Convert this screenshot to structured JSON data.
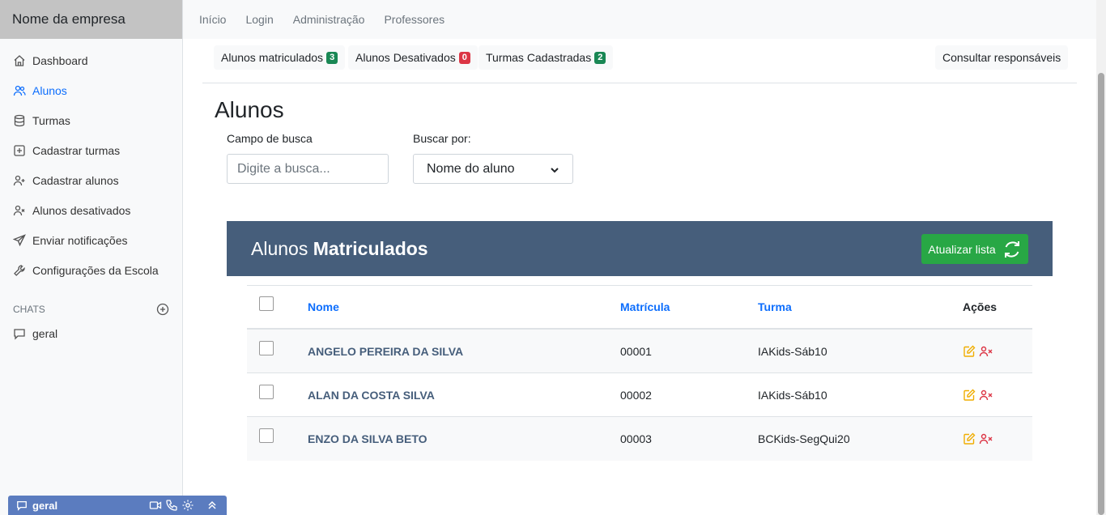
{
  "app": {
    "brand": "Nome da empresa"
  },
  "topnav": [
    "Início",
    "Login",
    "Administração",
    "Professores"
  ],
  "sidebar": {
    "items": [
      {
        "label": "Dashboard",
        "icon": "home-icon",
        "active": false
      },
      {
        "label": "Alunos",
        "icon": "users-icon",
        "active": true
      },
      {
        "label": "Turmas",
        "icon": "database-icon",
        "active": false
      },
      {
        "label": "Cadastrar turmas",
        "icon": "plus-square-icon",
        "active": false
      },
      {
        "label": "Cadastrar alunos",
        "icon": "user-plus-icon",
        "active": false
      },
      {
        "label": "Alunos desativados",
        "icon": "user-x-icon",
        "active": false
      },
      {
        "label": "Enviar notificações",
        "icon": "send-icon",
        "active": false
      },
      {
        "label": "Configurações da Escola",
        "icon": "wrench-icon",
        "active": false
      }
    ],
    "chats_label": "CHATS",
    "chats": [
      {
        "label": "geral",
        "icon": "message-icon"
      }
    ]
  },
  "stats": {
    "matriculados": {
      "label": "Alunos matriculados",
      "count": "3",
      "color": "#198754"
    },
    "desativados": {
      "label": "Alunos Desativados",
      "count": "0",
      "color": "#dc3545"
    },
    "turmas": {
      "label": "Turmas Cadastradas",
      "count": "2",
      "color": "#198754"
    },
    "consultar": "Consultar responsáveis"
  },
  "page": {
    "title": "Alunos",
    "search_label": "Campo de busca",
    "search_placeholder": "Digite a busca...",
    "search_by_label": "Buscar por:",
    "search_by_value": "Nome do aluno"
  },
  "card": {
    "title_prefix": "Alunos",
    "title_bold": "Matriculados",
    "refresh_label": "Atualizar lista",
    "header_color": "#465e7b",
    "refresh_color": "#28a745"
  },
  "table": {
    "headers": {
      "nome": "Nome",
      "matricula": "Matrícula",
      "turma": "Turma",
      "acoes": "Ações"
    },
    "rows": [
      {
        "nome": "ANGELO PEREIRA DA SILVA",
        "matricula": "00001",
        "turma": "IAKids-Sáb10"
      },
      {
        "nome": "ALAN DA COSTA SILVA",
        "matricula": "00002",
        "turma": "IAKids-Sáb10"
      },
      {
        "nome": "ENZO DA SILVA BETO",
        "matricula": "00003",
        "turma": "BCKids-SegQui20"
      }
    ]
  },
  "chatbar": {
    "label": "geral"
  }
}
